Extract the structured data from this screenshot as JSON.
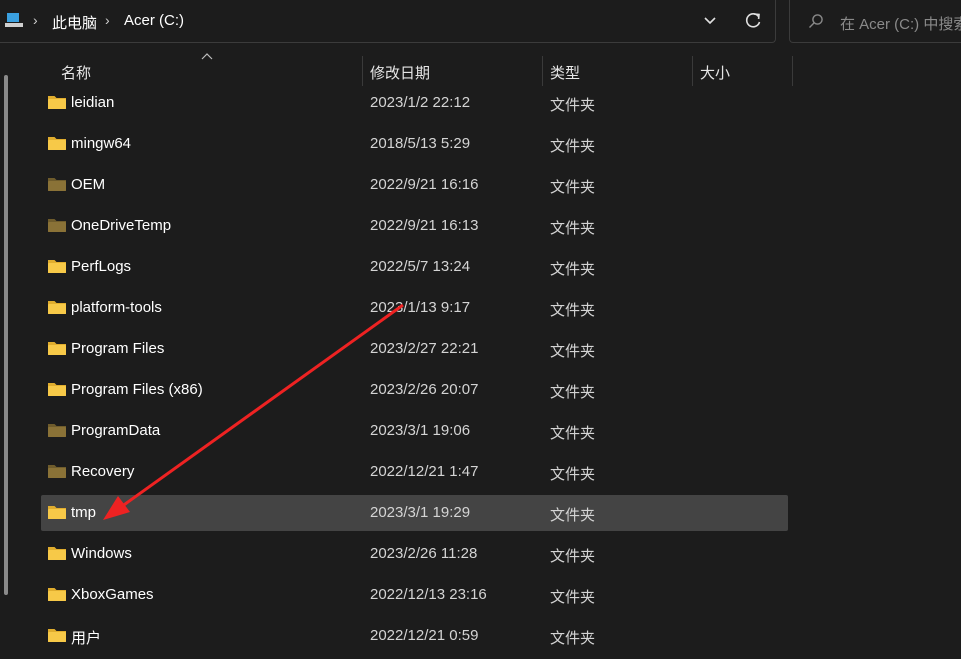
{
  "address_bar": {
    "pc_icon": "this-pc-icon",
    "breadcrumbs": [
      "此电脑",
      "Acer (C:)"
    ],
    "dropdown_icon": "chevron-down-icon",
    "refresh_icon": "refresh-icon"
  },
  "search": {
    "icon": "search-icon",
    "placeholder": "在 Acer (C:) 中搜索"
  },
  "columns": {
    "name": "名称",
    "date": "修改日期",
    "type": "类型",
    "size": "大小"
  },
  "files": [
    {
      "name": "leidian",
      "date": "2023/1/2 22:12",
      "type": "文件夹",
      "icon": "folder-icon"
    },
    {
      "name": "mingw64",
      "date": "2018/5/13 5:29",
      "type": "文件夹",
      "icon": "folder-icon"
    },
    {
      "name": "OEM",
      "date": "2022/9/21 16:16",
      "type": "文件夹",
      "icon": "folder-hidden-icon"
    },
    {
      "name": "OneDriveTemp",
      "date": "2022/9/21 16:13",
      "type": "文件夹",
      "icon": "folder-hidden-icon"
    },
    {
      "name": "PerfLogs",
      "date": "2022/5/7 13:24",
      "type": "文件夹",
      "icon": "folder-icon"
    },
    {
      "name": "platform-tools",
      "date": "2023/1/13 9:17",
      "type": "文件夹",
      "icon": "folder-icon"
    },
    {
      "name": "Program Files",
      "date": "2023/2/27 22:21",
      "type": "文件夹",
      "icon": "folder-icon"
    },
    {
      "name": "Program Files (x86)",
      "date": "2023/2/26 20:07",
      "type": "文件夹",
      "icon": "folder-icon"
    },
    {
      "name": "ProgramData",
      "date": "2023/3/1 19:06",
      "type": "文件夹",
      "icon": "folder-hidden-icon"
    },
    {
      "name": "Recovery",
      "date": "2022/12/21 1:47",
      "type": "文件夹",
      "icon": "folder-hidden-icon"
    },
    {
      "name": "tmp",
      "date": "2023/3/1 19:29",
      "type": "文件夹",
      "icon": "folder-icon",
      "selected": true
    },
    {
      "name": "Windows",
      "date": "2023/2/26 11:28",
      "type": "文件夹",
      "icon": "folder-icon"
    },
    {
      "name": "XboxGames",
      "date": "2022/12/13 23:16",
      "type": "文件夹",
      "icon": "folder-icon"
    },
    {
      "name": "用户",
      "date": "2022/12/21 0:59",
      "type": "文件夹",
      "icon": "folder-icon"
    }
  ],
  "annotation": {
    "icon": "red-arrow-icon",
    "color": "#ee2222"
  },
  "colors": {
    "background": "#1c1c1c",
    "selected_row": "#444444",
    "folder": "#f7c948",
    "folder_hidden": "#8a7237"
  }
}
